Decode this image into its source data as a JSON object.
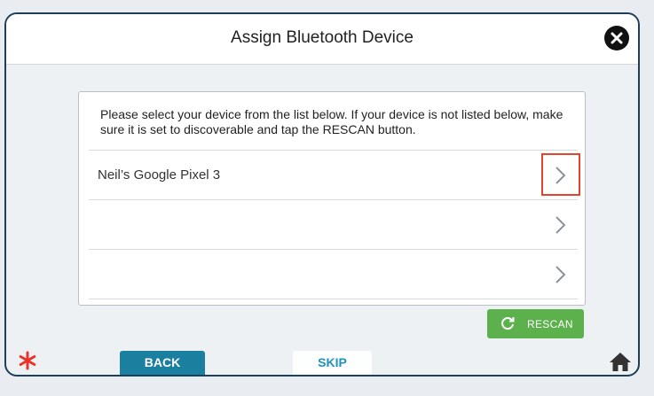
{
  "header": {
    "title": "Assign Bluetooth Device"
  },
  "panel": {
    "instructions": "Please select your device from the list below. If your device is not listed below, make sure it is set to discoverable and tap the RESCAN button.",
    "devices": [
      {
        "label": "Neil’s Google Pixel 3",
        "highlighted": true
      },
      {
        "label": "",
        "highlighted": false
      },
      {
        "label": "",
        "highlighted": false
      }
    ]
  },
  "rescan": {
    "label": "RESCAN"
  },
  "footer": {
    "back_label": "BACK",
    "skip_label": "SKIP"
  },
  "colors": {
    "frame_border": "#1d3f5c",
    "rescan_green": "#5db14d",
    "back_blue": "#1b7fa0",
    "skip_text": "#1f92bd",
    "highlight_red": "#e0452e",
    "asterisk_red": "#e8332a"
  },
  "icons": {
    "close": "close-icon",
    "chevron": "chevron-right-icon",
    "rescan": "refresh-icon",
    "asterisk": "asterisk-icon",
    "home": "home-icon"
  }
}
